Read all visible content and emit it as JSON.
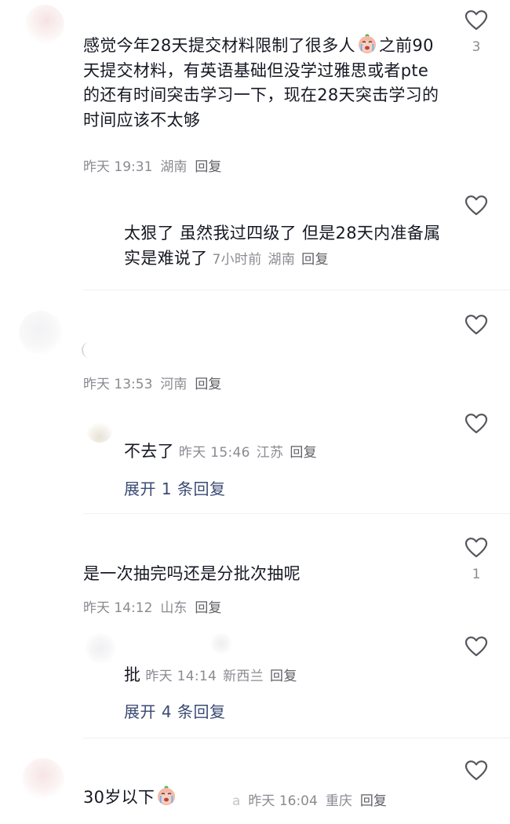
{
  "comments": [
    {
      "text_parts": [
        "感觉今年28天提交材料限制了很多人",
        "之前90天提交材料，有英语基础但没学过雅思或者pte的还有时间突击学习一下，现在28天突击学习的时间应该不太够"
      ],
      "emoji": "crying-face",
      "time": "昨天 19:31",
      "location": "湖南",
      "reply": "回复",
      "likes": "3",
      "replies": [
        {
          "text": "太狠了 虽然我过四级了 但是28天内准备属实是难说了",
          "time": "7小时前",
          "location": "湖南",
          "reply": "回复"
        }
      ]
    },
    {
      "time": "昨天 13:53",
      "location": "河南",
      "reply": "回复",
      "replies": [
        {
          "text": "不去了",
          "time": "昨天 15:46",
          "location": "江苏",
          "reply": "回复"
        }
      ],
      "expand": "展开 1 条回复"
    },
    {
      "text": "是一次抽完吗还是分批次抽呢",
      "time": "昨天 14:12",
      "location": "山东",
      "reply": "回复",
      "likes": "1",
      "replies": [
        {
          "text": "批",
          "time": "昨天 14:14",
          "location": "新西兰",
          "reply": "回复"
        }
      ],
      "expand": "展开 4 条回复"
    },
    {
      "text": "30岁以下",
      "emoji": "crying-face",
      "partial": "a",
      "time": "昨天 16:04",
      "location": "重庆",
      "reply": "回复"
    }
  ],
  "icons": {
    "like": "heart-outline-icon"
  },
  "colors": {
    "text": "#161823",
    "meta": "#8a8b91",
    "expand": "#3b4a74",
    "divider": "#f0f0f2"
  }
}
